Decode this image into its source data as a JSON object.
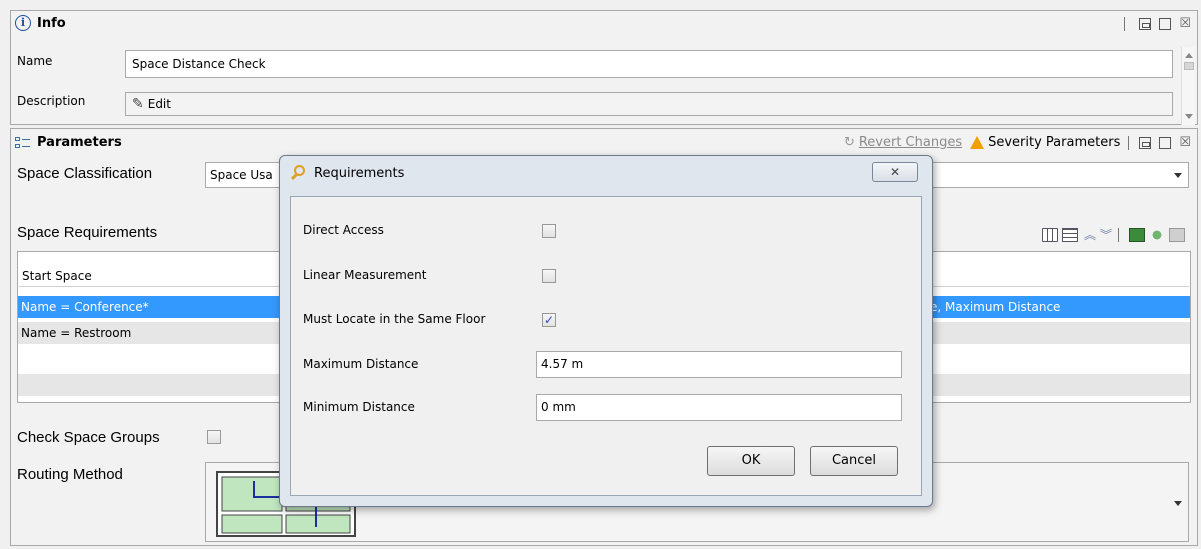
{
  "info": {
    "title": "Info",
    "name_label": "Name",
    "name_value": "Space Distance Check",
    "description_label": "Description",
    "edit_label": "Edit"
  },
  "parameters": {
    "title": "Parameters",
    "revert_changes": "Revert Changes",
    "severity_parameters": "Severity Parameters",
    "space_classification_label": "Space Classification",
    "space_classification_value": "Space Usa",
    "space_requirements_label": "Space Requirements",
    "table": {
      "header": "Start Space",
      "rows": [
        {
          "start": "Name = Conference*",
          "end": "e, Maximum Distance"
        },
        {
          "start": "Name = Restroom",
          "end": ""
        }
      ]
    },
    "check_space_groups_label": "Check Space Groups",
    "routing_method_label": "Routing Method"
  },
  "dialog": {
    "title": "Requirements",
    "fields": {
      "direct_access": "Direct Access",
      "linear_measurement": "Linear Measurement",
      "same_floor": "Must Locate in the Same Floor",
      "max_distance": "Maximum Distance",
      "max_distance_value": "4.57 m",
      "min_distance": "Minimum Distance",
      "min_distance_value": "0 mm"
    },
    "ok": "OK",
    "cancel": "Cancel"
  },
  "colors": {
    "selection": "#3399ff",
    "dialog_frame": "#dfe6ee",
    "warning": "#f0a000"
  },
  "icons": [
    "info-icon",
    "parameters-icon",
    "edit-icon",
    "revert-icon",
    "warning-icon",
    "requirements-icon",
    "close-icon"
  ]
}
